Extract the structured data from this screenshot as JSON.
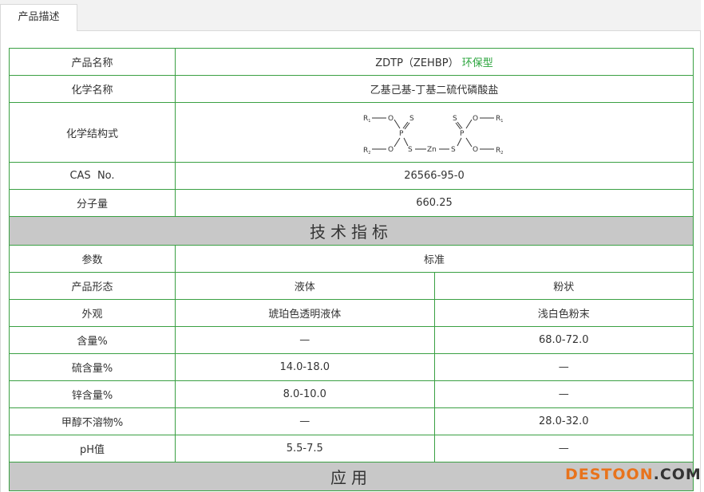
{
  "tab": {
    "label": "产品描述"
  },
  "info": {
    "name_label": "产品名称",
    "name_value": "ZDTP（ZEHBP）",
    "name_tag": "环保型",
    "chem_label": "化学名称",
    "chem_value": "乙基己基-丁基二硫代磷酸盐",
    "struct_label": "化学结构式",
    "cas_label": "CAS  No.",
    "cas_value": "26566-95-0",
    "mw_label": "分子量",
    "mw_value": "660.25"
  },
  "structure": {
    "r1": "R",
    "r1_sub": "1",
    "r2": "R",
    "r2_sub": "2",
    "o": "O",
    "p": "P",
    "s": "S",
    "zn": "Zn"
  },
  "spec": {
    "title": "技术指标",
    "param_label": "参数",
    "standard_label": "标准",
    "rows": [
      {
        "label": "产品形态",
        "liquid": "液体",
        "powder": "粉状"
      },
      {
        "label": "外观",
        "liquid": "琥珀色透明液体",
        "powder": "浅白色粉末"
      },
      {
        "label": "含量%",
        "liquid": "—",
        "powder": "68.0-72.0"
      },
      {
        "label": "硫含量%",
        "liquid": "14.0-18.0",
        "powder": "—"
      },
      {
        "label": "锌含量%",
        "liquid": "8.0-10.0",
        "powder": "—"
      },
      {
        "label": "甲醇不溶物%",
        "liquid": "—",
        "powder": "28.0-32.0"
      },
      {
        "label": "pH值",
        "liquid": "5.5-7.5",
        "powder": "—"
      }
    ]
  },
  "application": {
    "title": "应用"
  },
  "watermark": {
    "brand": "DESTOON",
    "suffix": ".COM"
  }
}
